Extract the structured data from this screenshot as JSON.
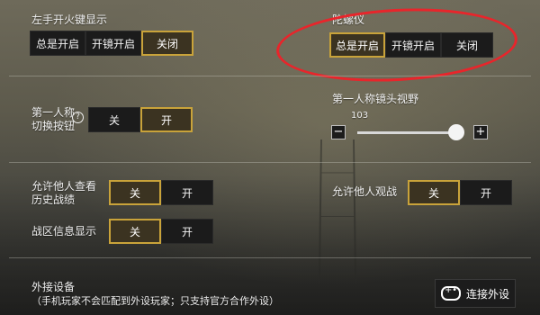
{
  "left_fire": {
    "title": "左手开火键显示",
    "options": [
      "总是开启",
      "开镜开启",
      "关闭"
    ],
    "selected": "关闭"
  },
  "gyroscope": {
    "title": "陀螺仪",
    "options": [
      "总是开启",
      "开镜开启",
      "关闭"
    ],
    "selected": "总是开启"
  },
  "fpp_switch": {
    "title_line1": "第一人称",
    "title_line2": "切换按钮",
    "help": "?",
    "options": [
      "关",
      "开"
    ],
    "selected": "开"
  },
  "fpp_fov": {
    "title": "第一人称镜头视野",
    "value": "103",
    "minus": "−",
    "plus": "+",
    "level": 0.93
  },
  "history_view": {
    "title_line1": "允许他人查看",
    "title_line2": "历史战绩",
    "options": [
      "关",
      "开"
    ],
    "selected": "关"
  },
  "spectate": {
    "title": "允许他人观战",
    "options": [
      "关",
      "开"
    ],
    "selected": "关"
  },
  "zone_info": {
    "title": "战区信息显示",
    "options": [
      "关",
      "开"
    ],
    "selected": "关"
  },
  "external_device": {
    "title": "外接设备",
    "note": "（手机玩家不会匹配到外设玩家；只支持官方合作外设）",
    "button_label": "连接外设",
    "button_icon": "gamepad-icon"
  },
  "colors": {
    "selected_border": "#c9a33a",
    "highlight_ring": "#e8252b"
  }
}
